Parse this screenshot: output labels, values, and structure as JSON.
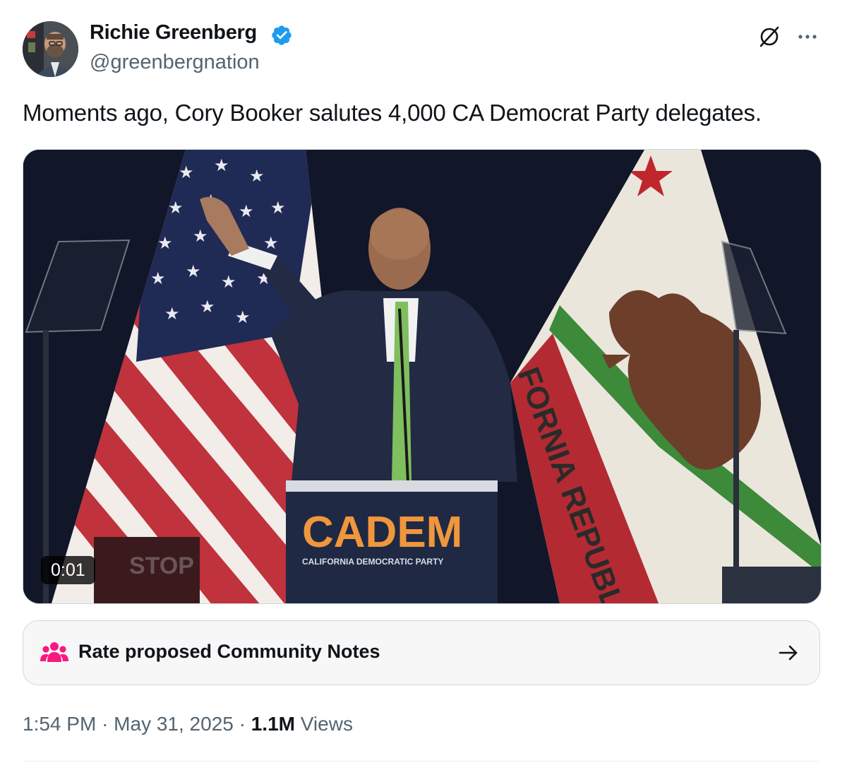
{
  "author": {
    "display_name": "Richie Greenberg",
    "handle": "@greenbergnation",
    "verified": true
  },
  "tweet": {
    "text": "Moments ago, Cory Booker salutes 4,000 CA Democrat Party delegates."
  },
  "media": {
    "type": "video",
    "duration": "0:01",
    "podium_logo": "CADEM",
    "podium_subtitle": "CALIFORNIA DEMOCRATIC PARTY",
    "flag_text": "FORNIA REPUBL",
    "sign_text": "STOP"
  },
  "community_notes": {
    "label": "Rate proposed Community Notes",
    "icon": "people-icon",
    "icon_color": "#f91880"
  },
  "meta": {
    "time": "1:54 PM",
    "separator": "·",
    "date": "May 31, 2025",
    "views_count": "1.1M",
    "views_label": "Views"
  },
  "icons": {
    "verified": "verified-badge-icon",
    "grok": "grok-icon",
    "more": "more-icon",
    "arrow": "arrow-right-icon"
  },
  "colors": {
    "verified_blue": "#1d9bf0",
    "text_primary": "#0f1419",
    "text_secondary": "#536471"
  }
}
